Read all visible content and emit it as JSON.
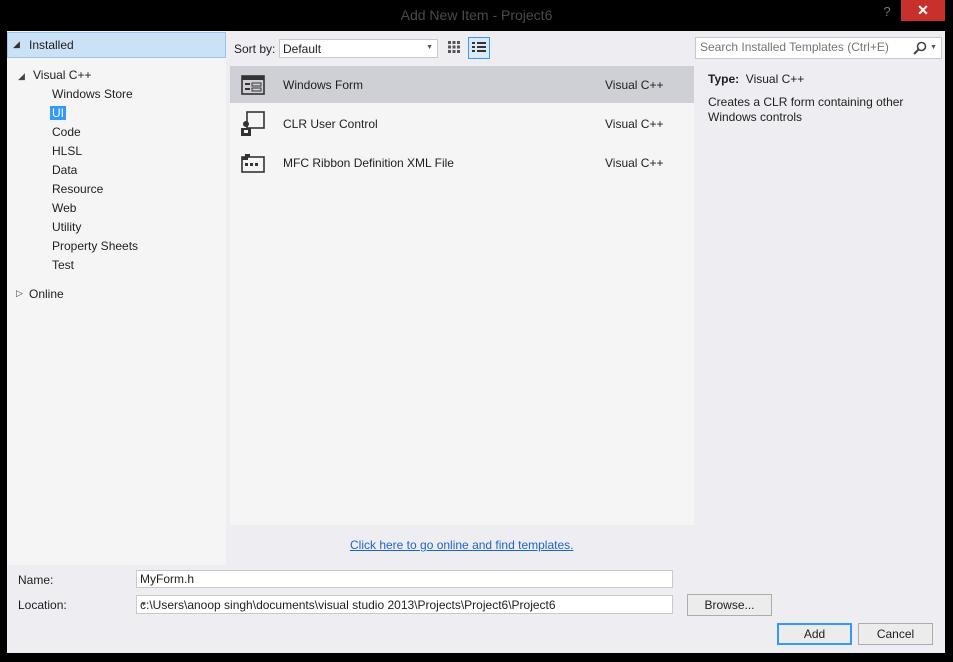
{
  "window": {
    "title": "Add New Item - Project6",
    "help_label": "?",
    "close_label": "✕"
  },
  "tree": {
    "installed_label": "Installed",
    "visual_cpp_label": "Visual C++",
    "children": [
      "Windows Store",
      "UI",
      "Code",
      "HLSL",
      "Data",
      "Resource",
      "Web",
      "Utility",
      "Property Sheets",
      "Test"
    ],
    "selected": "UI",
    "online_label": "Online"
  },
  "toolbar": {
    "sort_by_label": "Sort by:",
    "sort_value": "Default"
  },
  "search": {
    "placeholder": "Search Installed Templates (Ctrl+E)"
  },
  "templates": [
    {
      "name": "Windows Form",
      "language": "Visual C++",
      "icon": "windows-form-icon"
    },
    {
      "name": "CLR User Control",
      "language": "Visual C++",
      "icon": "user-control-icon"
    },
    {
      "name": "MFC Ribbon Definition XML File",
      "language": "Visual C++",
      "icon": "ribbon-icon"
    }
  ],
  "details": {
    "type_label": "Type:",
    "type_value": "Visual C++",
    "description": "Creates a CLR form containing other Windows controls"
  },
  "online_link": "Click here to go online and find templates.",
  "form": {
    "name_label": "Name:",
    "name_value": "MyForm.h",
    "location_label": "Location:",
    "location_value": "c:\\Users\\anoop singh\\documents\\visual studio 2013\\Projects\\Project6\\Project6",
    "browse_label": "Browse...",
    "add_label": "Add",
    "cancel_label": "Cancel"
  },
  "colors": {
    "accent": "#3399ff",
    "close": "#c7302b",
    "link": "#1e64c8"
  }
}
